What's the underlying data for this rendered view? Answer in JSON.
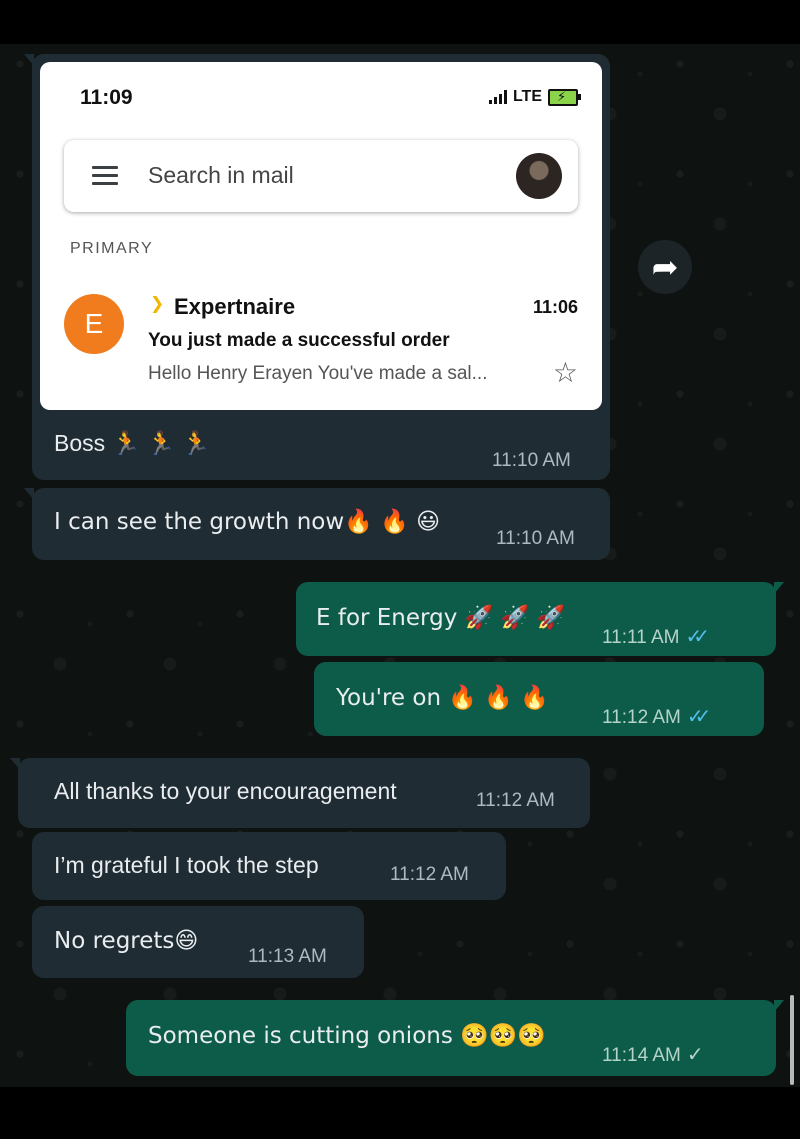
{
  "status": {
    "time": "11:09",
    "network": "LTE"
  },
  "gmail": {
    "search_placeholder": "Search in mail",
    "section_label": "PRIMARY",
    "email": {
      "avatar_letter": "E",
      "sender": "Expertnaire",
      "time": "11:06",
      "subject": "You just made a successful order",
      "snippet": "Hello Henry Erayen You've made a sal..."
    }
  },
  "messages": [
    {
      "dir": "in",
      "text": "Boss 🏃 🏃 🏃",
      "time": "11:10 AM"
    },
    {
      "dir": "in",
      "text": "I can see the growth now🔥 🔥 😃",
      "time": "11:10 AM"
    },
    {
      "dir": "out",
      "text": "E for Energy 🚀 🚀 🚀",
      "time": "11:11 AM",
      "status": "read"
    },
    {
      "dir": "out",
      "text": "You're on 🔥 🔥 🔥",
      "time": "11:12 AM",
      "status": "read"
    },
    {
      "dir": "in",
      "text": "All thanks to your encouragement",
      "time": "11:12 AM"
    },
    {
      "dir": "in",
      "text": "I’m grateful I took the step",
      "time": "11:12 AM"
    },
    {
      "dir": "in",
      "text": "No regrets😄",
      "time": "11:13 AM"
    },
    {
      "dir": "out",
      "text": "Someone is cutting onions 🥺🥺🥺",
      "time": "11:14 AM",
      "status": "sent"
    }
  ],
  "colors": {
    "incoming_bubble": "#1f2c33",
    "outgoing_bubble": "#0d5c4a",
    "read_ticks": "#53bdeb",
    "gmail_avatar": "#f07c1e"
  },
  "icons": [
    "menu-icon",
    "star-icon",
    "forward-icon",
    "important-icon",
    "double-check-icon",
    "single-check-icon"
  ]
}
